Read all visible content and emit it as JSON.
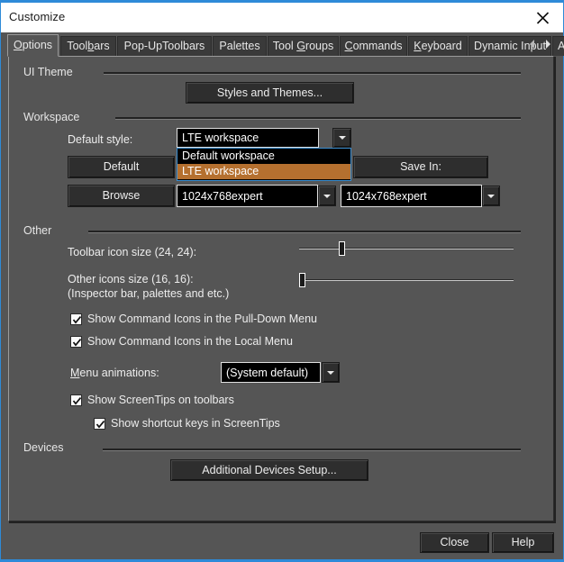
{
  "window": {
    "title": "Customize",
    "close_icon": "close-icon",
    "accent_color": "#2e8ad8",
    "titlebar_bg": "#ffffff",
    "body_bg": "#555555"
  },
  "tabs": {
    "items": [
      {
        "label": "Options",
        "mnemonic": "O",
        "active": true
      },
      {
        "label": "Toolbars",
        "mnemonic": "b",
        "active": false
      },
      {
        "label": "Pop-UpToolbars",
        "mnemonic": "",
        "active": false
      },
      {
        "label": "Palettes",
        "mnemonic": "",
        "active": false
      },
      {
        "label": "Tool Groups",
        "mnemonic": "G",
        "active": false
      },
      {
        "label": "Commands",
        "mnemonic": "C",
        "active": false
      },
      {
        "label": "Keyboard",
        "mnemonic": "K",
        "active": false
      },
      {
        "label": "Dynamic Input",
        "mnemonic": "",
        "active": false
      },
      {
        "label": "Ali",
        "mnemonic": "",
        "active": false
      }
    ],
    "scroll_left_icon": "chevron-left-icon",
    "scroll_right_icon": "chevron-right-icon"
  },
  "groups": {
    "ui_theme": "UI Theme",
    "workspace": "Workspace",
    "other": "Other",
    "devices": "Devices"
  },
  "ui_theme": {
    "styles_button": "Styles and Themes..."
  },
  "workspace": {
    "default_style_label": "Default style:",
    "default_style_value": "LTE workspace",
    "dropdown_open": true,
    "dropdown_options": [
      "Default workspace",
      "LTE workspace"
    ],
    "dropdown_selected": "LTE workspace",
    "dropdown_highlight_color": "#b5702f",
    "default_button": "Default",
    "browse_button": "Browse",
    "save_in_button": "Save In:",
    "left_profile_value": "1024x768expert",
    "right_profile_value": "1024x768expert"
  },
  "other": {
    "toolbar_icon_size_label": "Toolbar icon size (24, 24):",
    "toolbar_icon_size_value": 20,
    "other_icons_size_label_line1": "Other icons size (16, 16):",
    "other_icons_size_label_line2": "(Inspector bar, palettes and etc.)",
    "other_icons_size_value": 0,
    "checkbox_pulldown": "Show Command Icons in the Pull-Down Menu",
    "checkbox_pulldown_checked": true,
    "checkbox_local": "Show Command Icons in the Local Menu",
    "checkbox_local_checked": true,
    "menu_animations_label": "Menu animations:",
    "menu_animations_mnemonic": "M",
    "menu_animations_value": "(System default)",
    "checkbox_screentips": "Show ScreenTips on toolbars",
    "checkbox_screentips_checked": true,
    "checkbox_shortcut_keys": "Show shortcut keys in ScreenTips",
    "checkbox_shortcut_keys_checked": true
  },
  "devices": {
    "setup_button": "Additional Devices Setup..."
  },
  "footer": {
    "close_button": "Close",
    "help_button": "Help"
  }
}
